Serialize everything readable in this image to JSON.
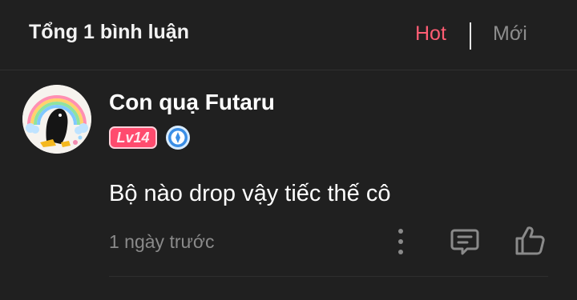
{
  "header": {
    "title": "Tổng 1 bình luận",
    "sort_hot": "Hot",
    "sort_new": "Mới"
  },
  "comment": {
    "avatar_icon": "crow-rainbow-avatar-icon",
    "username": "Con quạ Futaru",
    "level": "Lv14",
    "rank_icon": "blue-rank-medal-icon",
    "text": "Bộ nào drop vậy tiếc thế cô",
    "timestamp": "1 ngày trước",
    "actions": {
      "more_icon": "more-vertical-icon",
      "reply_icon": "comment-reply-icon",
      "like_icon": "thumbs-up-icon"
    }
  },
  "colors": {
    "background": "#202020",
    "accent_hot": "#ff5d73",
    "inactive": "#8d8d8d",
    "level_badge": "#ff4b6e",
    "rank_blue": "#3a8ee6"
  }
}
